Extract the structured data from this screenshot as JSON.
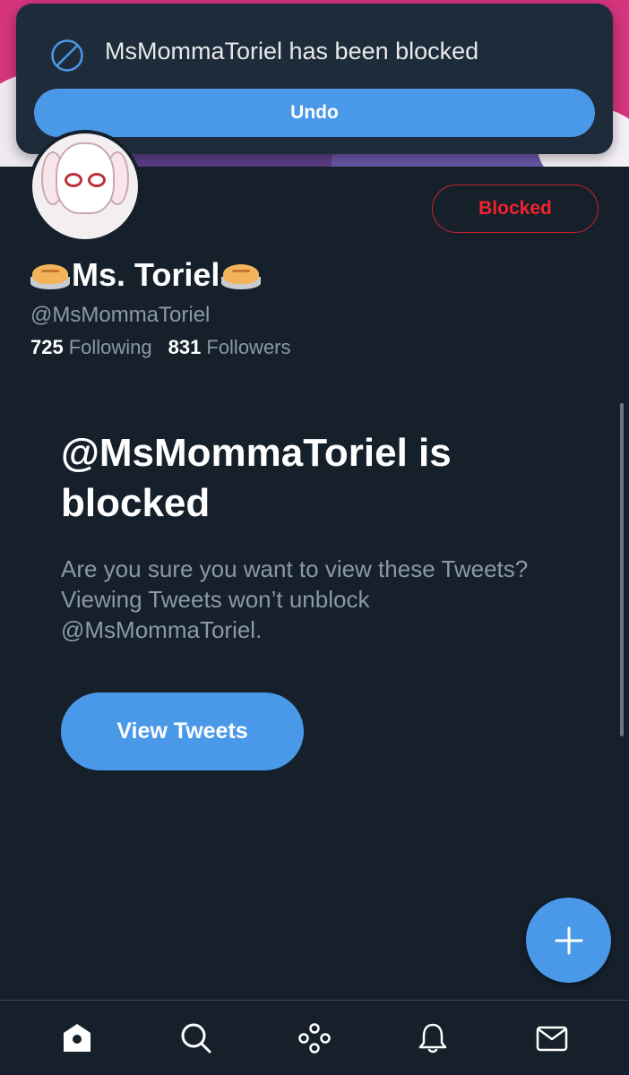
{
  "toast": {
    "message": "MsMommaToriel has been blocked",
    "undo_label": "Undo",
    "icon": "block-icon"
  },
  "profile": {
    "display_name": "Ms. Toriel",
    "name_emoji": "pie",
    "handle": "@MsMommaToriel",
    "following_count": "725",
    "following_label": "Following",
    "followers_count": "831",
    "followers_label": "Followers",
    "blocked_button_label": "Blocked"
  },
  "blocked_notice": {
    "title": "@MsMommaToriel is blocked",
    "description": "Are you sure you want to view these Tweets? Viewing Tweets won’t unblock @MsMommaToriel.",
    "view_button_label": "View Tweets"
  },
  "fab": {
    "icon": "plus-icon"
  },
  "bottom_nav": {
    "items": [
      {
        "name": "home",
        "icon": "home-icon"
      },
      {
        "name": "search",
        "icon": "search-icon"
      },
      {
        "name": "spaces",
        "icon": "spaces-icon"
      },
      {
        "name": "notifications",
        "icon": "bell-icon"
      },
      {
        "name": "messages",
        "icon": "mail-icon"
      }
    ]
  },
  "colors": {
    "background": "#15202b",
    "accent": "#4a99e9",
    "danger": "#f4212e",
    "muted_text": "#8b98a5"
  }
}
